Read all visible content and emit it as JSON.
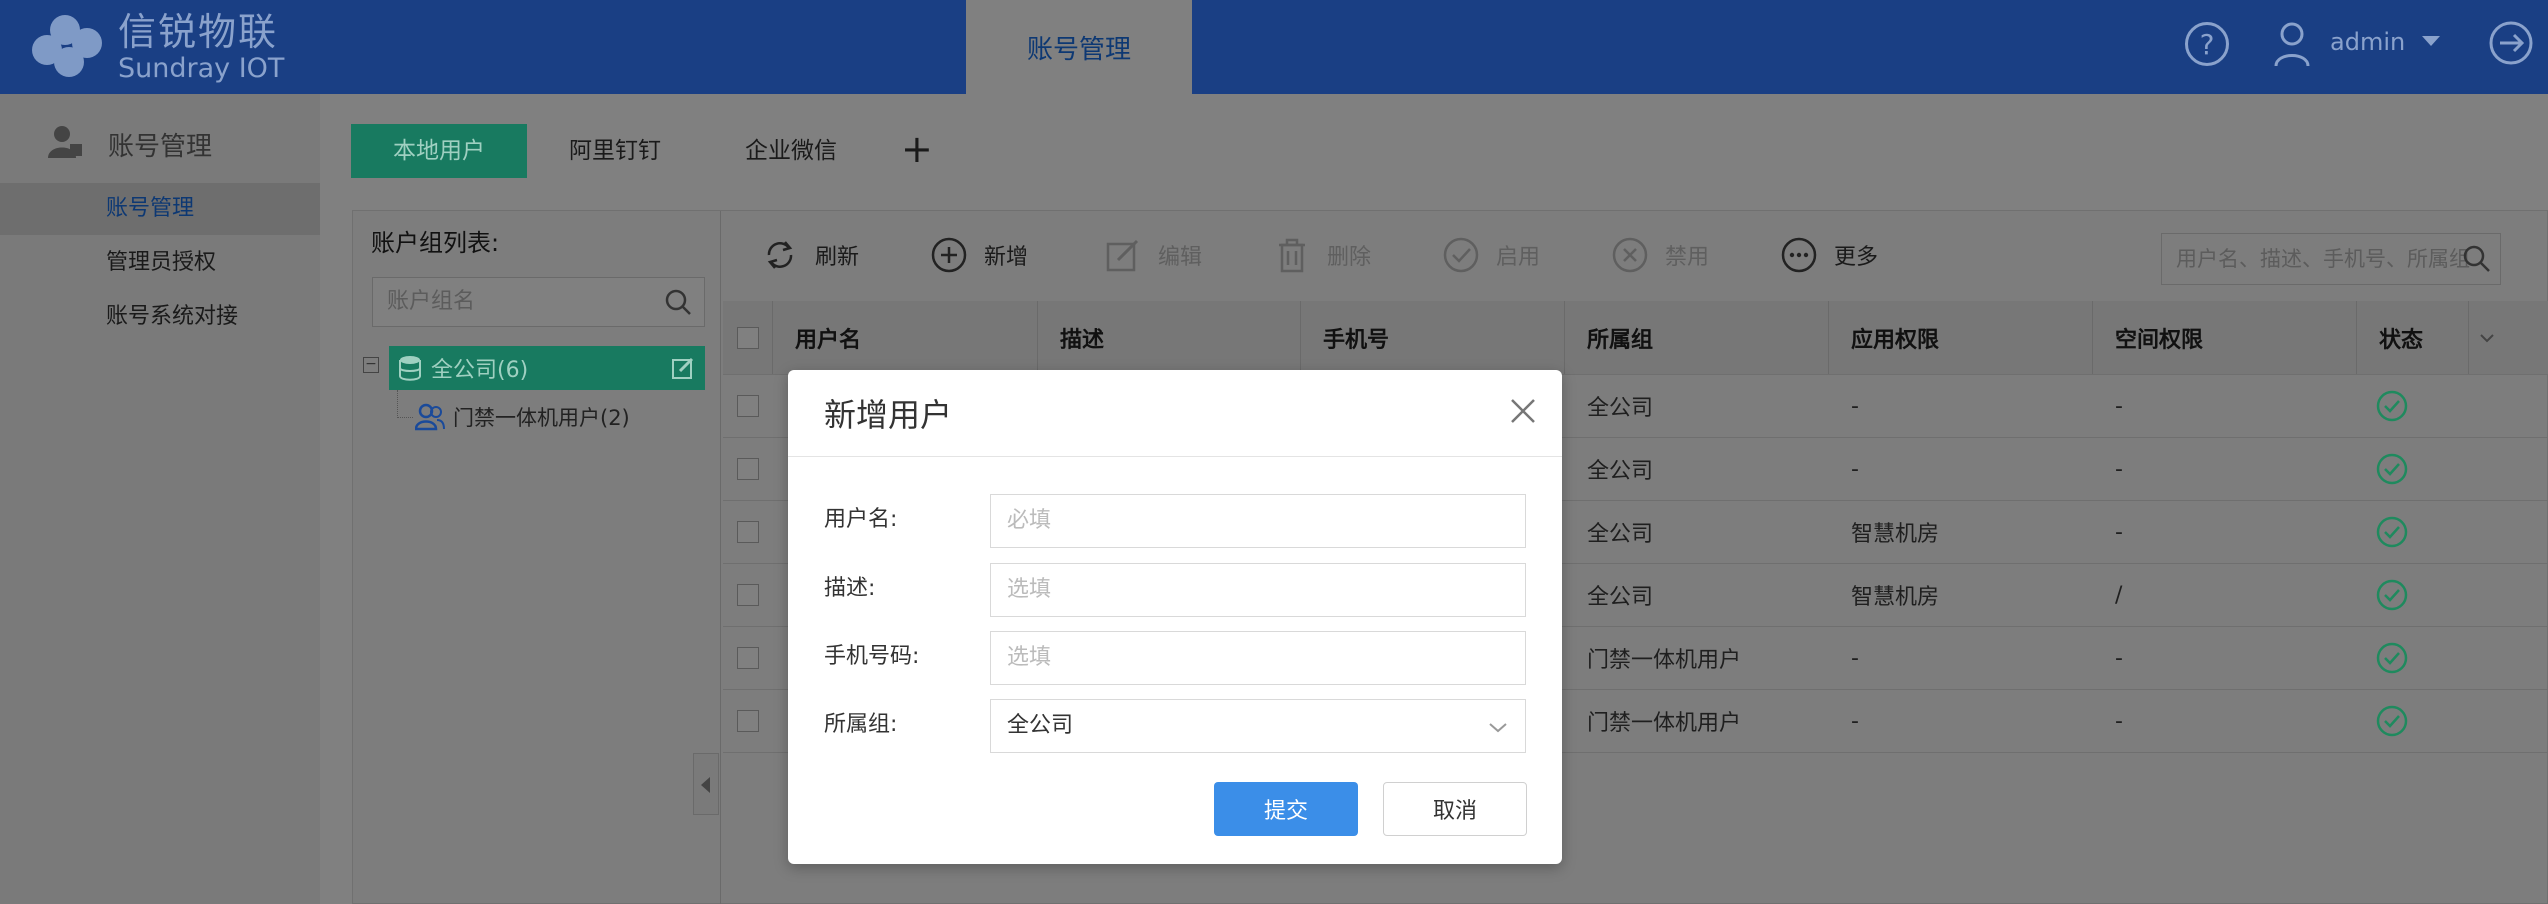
{
  "header": {
    "logo_cn": "信锐物联",
    "logo_en": "Sundray IOT",
    "active_tab": "账号管理",
    "username": "admin"
  },
  "sidebar": {
    "section_title": "账号管理",
    "items": [
      {
        "label": "账号管理",
        "active": true
      },
      {
        "label": "管理员授权",
        "active": false
      },
      {
        "label": "账号系统对接",
        "active": false
      }
    ]
  },
  "tabs": [
    {
      "label": "本地用户",
      "active": true
    },
    {
      "label": "阿里钉钉",
      "active": false
    },
    {
      "label": "企业微信",
      "active": false
    }
  ],
  "tab_add": "+",
  "group_panel": {
    "title": "账户组列表:",
    "search_placeholder": "账户组名",
    "tree_toggle": "−",
    "root": "全公司(6)",
    "child": "门禁一体机用户(2)"
  },
  "toolbar": {
    "refresh": "刷新",
    "add": "新增",
    "edit": "编辑",
    "delete": "删除",
    "enable": "启用",
    "disable": "禁用",
    "more": "更多",
    "search_placeholder": "用户名、描述、手机号、所属组"
  },
  "table": {
    "columns": [
      "用户名",
      "描述",
      "手机号",
      "所属组",
      "应用权限",
      "空间权限",
      "状态"
    ],
    "rows": [
      {
        "group": "全公司",
        "app": "-",
        "space": "-",
        "status": "enabled"
      },
      {
        "group": "全公司",
        "app": "-",
        "space": "-",
        "status": "enabled"
      },
      {
        "group": "全公司",
        "app": "智慧机房",
        "space": "-",
        "status": "enabled"
      },
      {
        "group": "全公司",
        "app": "智慧机房",
        "space": "/",
        "status": "enabled"
      },
      {
        "group": "门禁一体机用户",
        "app": "-",
        "space": "-",
        "status": "enabled"
      },
      {
        "group": "门禁一体机用户",
        "app": "-",
        "space": "-",
        "status": "enabled"
      }
    ]
  },
  "modal": {
    "title": "新增用户",
    "fields": [
      {
        "label": "用户名:",
        "placeholder": "必填"
      },
      {
        "label": "描述:",
        "placeholder": "选填"
      },
      {
        "label": "手机号码:",
        "placeholder": "选填"
      },
      {
        "label": "所属组:",
        "value": "全公司"
      }
    ],
    "submit": "提交",
    "cancel": "取消"
  },
  "colors": {
    "header_bg": "#1a3f84",
    "accent_green": "#187a60",
    "primary_blue": "#3b8ee8",
    "status_green": "#1f8a5e"
  }
}
